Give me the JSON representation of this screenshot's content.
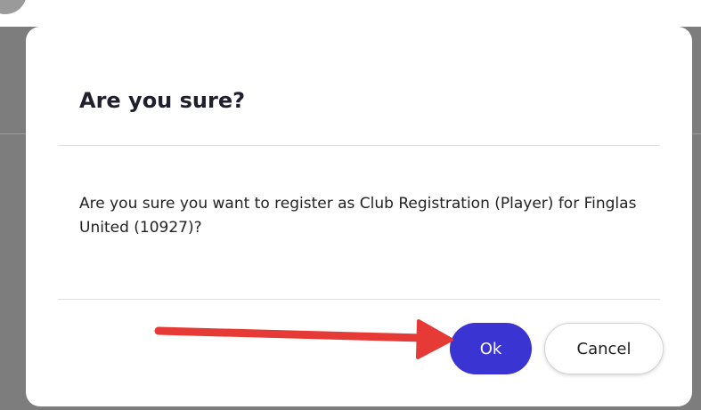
{
  "dialog": {
    "title": "Are you sure?",
    "message": "Are you sure you want to register as Club Registration (Player) for Finglas United (10927)?",
    "ok_label": "Ok",
    "cancel_label": "Cancel"
  },
  "colors": {
    "overlay": "#7d7d7d",
    "primary_button": "#3a34d2",
    "annotation_arrow": "#e53a35"
  },
  "annotation": {
    "icon": "red-arrow-icon"
  }
}
